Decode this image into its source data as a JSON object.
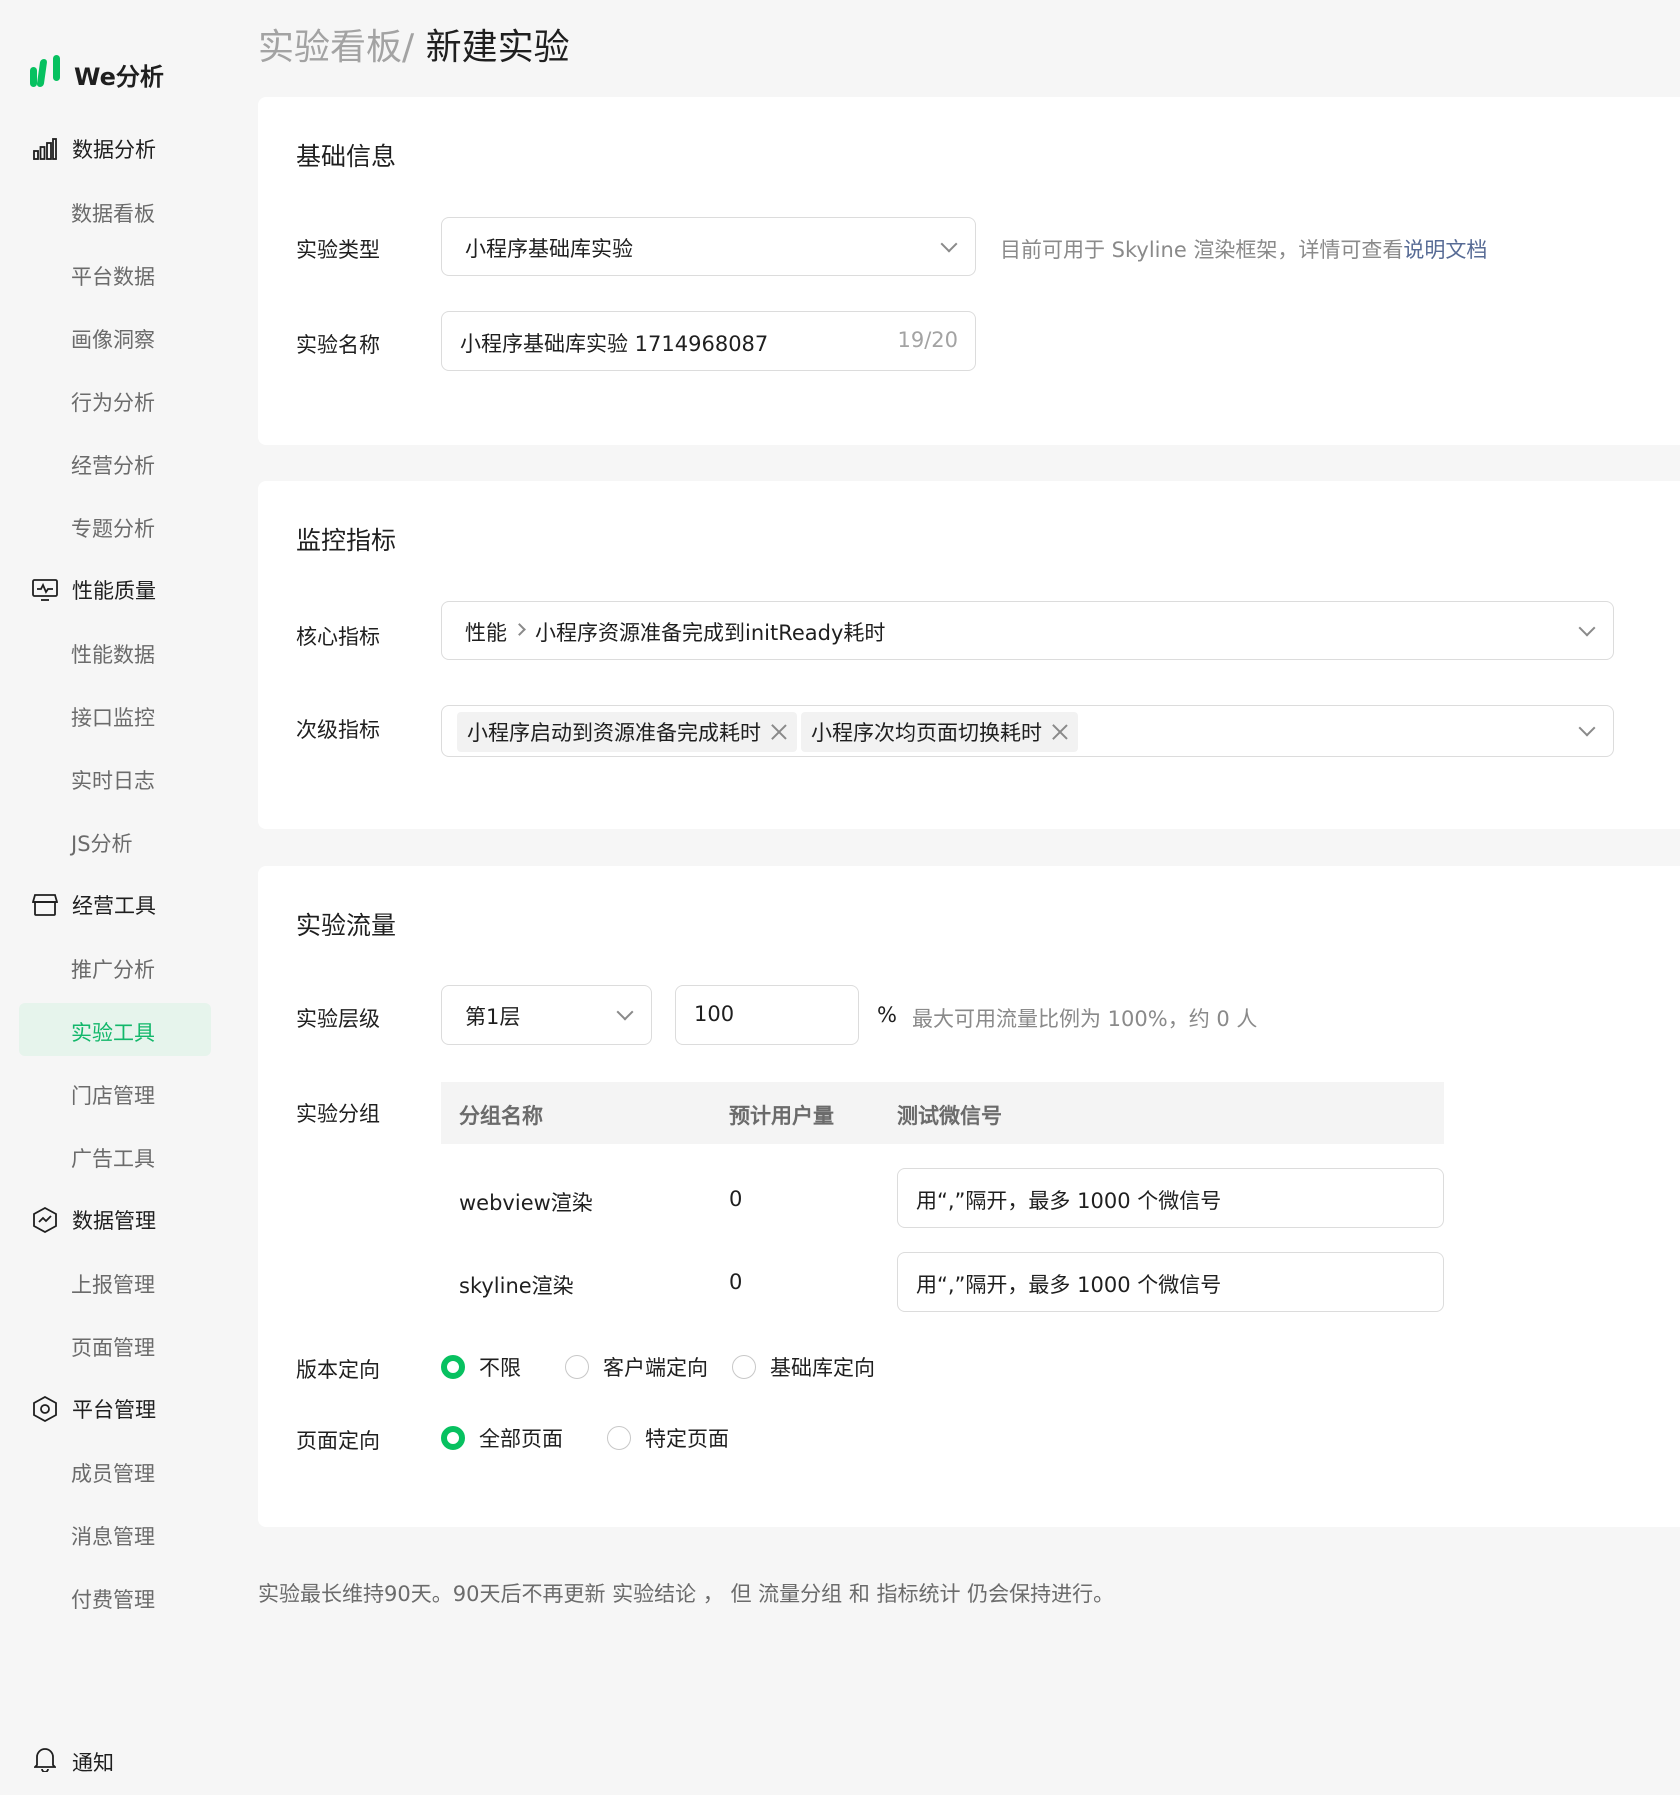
{
  "brand": {
    "name": "We分析",
    "icon": "bar-logo-icon",
    "color": "#07c160"
  },
  "sidebar": {
    "groups": [
      {
        "label": "数据分析",
        "icon": "bar-chart-icon",
        "items": [
          "数据看板",
          "平台数据",
          "画像洞察",
          "行为分析",
          "经营分析",
          "专题分析"
        ]
      },
      {
        "label": "性能质量",
        "icon": "monitor-icon",
        "items": [
          "性能数据",
          "接口监控",
          "实时日志",
          "JS分析"
        ]
      },
      {
        "label": "经营工具",
        "icon": "store-icon",
        "items": [
          "推广分析",
          "实验工具",
          "门店管理",
          "广告工具"
        ]
      },
      {
        "label": "数据管理",
        "icon": "data-hex-icon",
        "items": [
          "上报管理",
          "页面管理"
        ]
      },
      {
        "label": "平台管理",
        "icon": "settings-hex-icon",
        "items": [
          "成员管理",
          "消息管理",
          "付费管理"
        ]
      }
    ],
    "active_item": "实验工具",
    "notify": "通知"
  },
  "breadcrumb": {
    "parent": "实验看板/",
    "current": "新建实验"
  },
  "basic": {
    "title": "基础信息",
    "type_label": "实验类型",
    "type_value": "小程序基础库实验",
    "type_hint": "目前可用于 Skyline 渲染框架，详情可查看",
    "type_hint_link": "说明文档",
    "name_label": "实验名称",
    "name_value": "小程序基础库实验 1714968087",
    "name_count": "19/20"
  },
  "metrics": {
    "title": "监控指标",
    "core_label": "核心指标",
    "core_category": "性能",
    "core_value": "小程序资源准备完成到initReady耗时",
    "secondary_label": "次级指标",
    "secondary_tags": [
      "小程序启动到资源准备完成耗时",
      "小程序次均页面切换耗时"
    ]
  },
  "traffic": {
    "title": "实验流量",
    "layer_label": "实验层级",
    "layer_value": "第1层",
    "percent_value": "100",
    "percent_sign": "%",
    "percent_hint": "最大可用流量比例为 100%，约 0 人",
    "group_label": "实验分组",
    "columns": [
      "分组名称",
      "预计用户量",
      "测试微信号"
    ],
    "rows": [
      {
        "name": "webview渲染",
        "users": "0",
        "placeholder": "用“,”隔开，最多 1000 个微信号"
      },
      {
        "name": "skyline渲染",
        "users": "0",
        "placeholder": "用“,”隔开，最多 1000 个微信号"
      }
    ],
    "version_label": "版本定向",
    "version_options": [
      "不限",
      "客户端定向",
      "基础库定向"
    ],
    "version_selected": "不限",
    "page_label": "页面定向",
    "page_options": [
      "全部页面",
      "特定页面"
    ],
    "page_selected": "全部页面"
  },
  "footer_note": "实验最长维持90天。90天后不再更新 实验结论 ， 但 流量分组 和 指标统计 仍会保持进行。"
}
